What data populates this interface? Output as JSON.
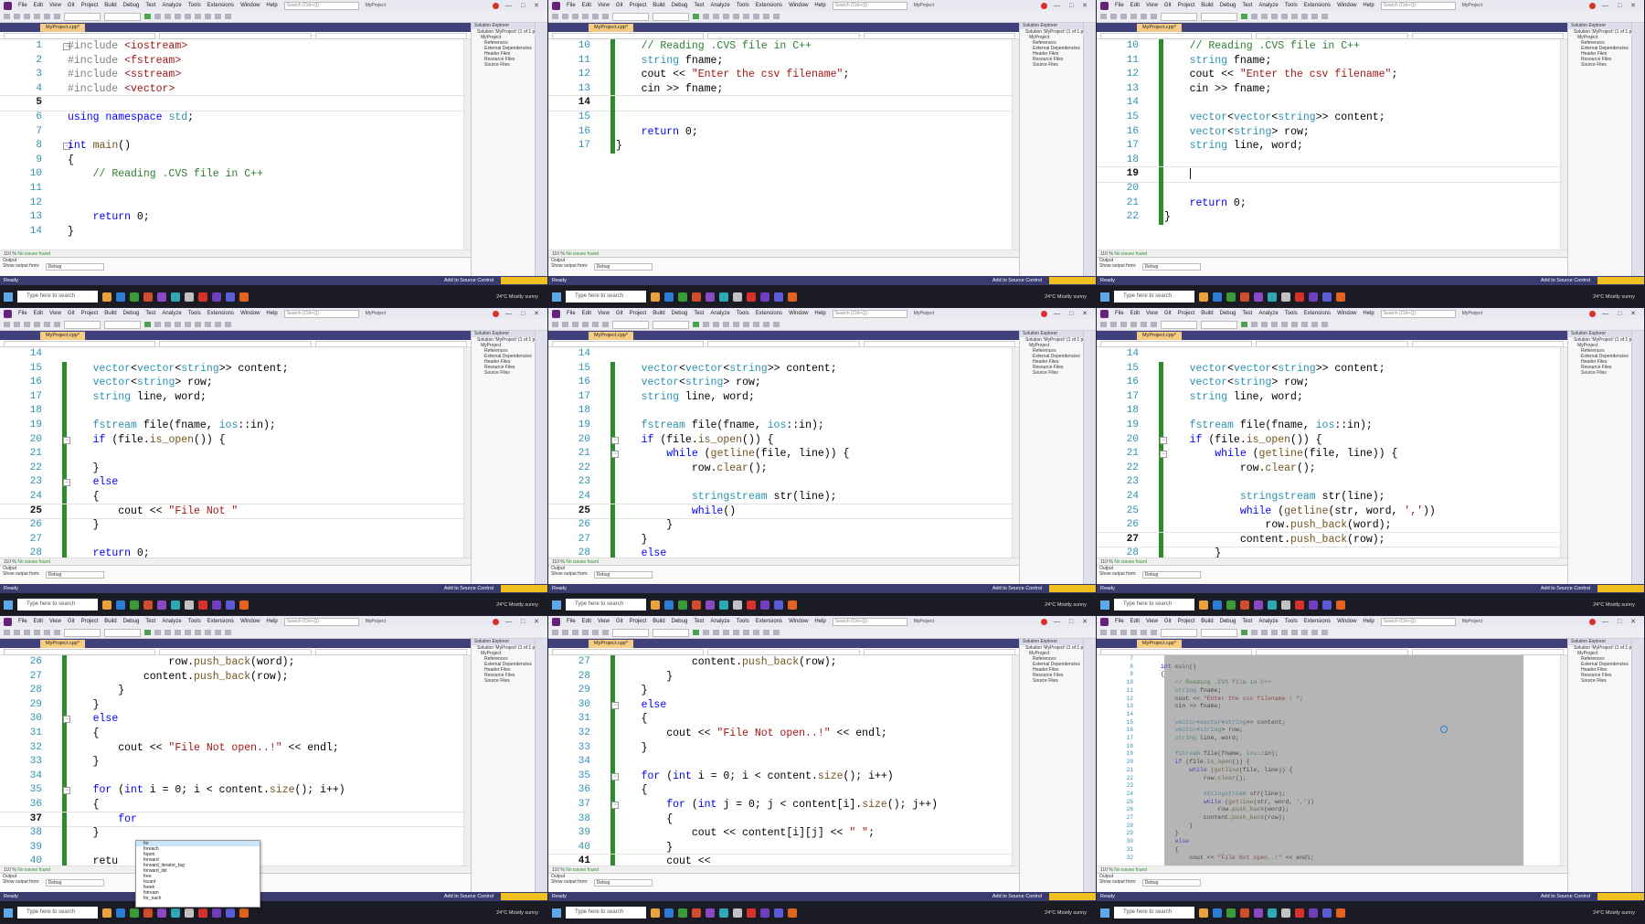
{
  "menu": [
    "File",
    "Edit",
    "View",
    "Git",
    "Project",
    "Build",
    "Debug",
    "Test",
    "Analyze",
    "Tools",
    "Extensions",
    "Window",
    "Help"
  ],
  "search_placeholder": "Search (Ctrl+Q)",
  "project_name": "MyProject",
  "tab_label": "MyProject.cpp*",
  "live_share": "Live Share",
  "status_ok": "No issues found",
  "output_title": "Output",
  "output_show": "Show output from:",
  "output_source": "Debug",
  "solution": {
    "title": "Solution Explorer",
    "items": [
      "Solution 'MyProject' (1 of 1 project)",
      "MyProject",
      "References",
      "External Dependencies",
      "Header Files",
      "Resource Files",
      "Source Files"
    ],
    "tabs": [
      "Solution Explorer",
      "Git Changes"
    ]
  },
  "vs_status": "Ready",
  "add_to_source": "Add to Source Control",
  "taskbar_search": "Type here to search",
  "weather": "24°C Mostly sunny",
  "clock_time": "",
  "colors": {
    "accent": "#68217a",
    "tab_active": "#f5cc84",
    "change_margin": "#2e8b2e",
    "statusbar": "#3a3b6e",
    "taskbar": "#1b1b24"
  },
  "panels": [
    {
      "lines": [
        {
          "n": "1",
          "t": "#include <iostream>"
        },
        {
          "n": "2",
          "t": "#include <fstream>"
        },
        {
          "n": "3",
          "t": "#include <sstream>"
        },
        {
          "n": "4",
          "t": "#include <vector>"
        },
        {
          "n": "5",
          "t": ""
        },
        {
          "n": "6",
          "t": "using namespace std;"
        },
        {
          "n": "7",
          "t": ""
        },
        {
          "n": "8",
          "t": "int main()"
        },
        {
          "n": "9",
          "t": "{"
        },
        {
          "n": "10",
          "t": "    // Reading .CVS file in C++"
        },
        {
          "n": "11",
          "t": ""
        },
        {
          "n": "12",
          "t": ""
        },
        {
          "n": "13",
          "t": "    return 0;"
        },
        {
          "n": "14",
          "t": "}"
        }
      ]
    },
    {
      "lines": [
        {
          "n": "10",
          "t": "    // Reading .CVS file in C++"
        },
        {
          "n": "11",
          "t": "    string fname;"
        },
        {
          "n": "12",
          "t": "    cout << \"Enter the csv filename\";"
        },
        {
          "n": "13",
          "t": "    cin >> fname;"
        },
        {
          "n": "14",
          "t": ""
        },
        {
          "n": "15",
          "t": ""
        },
        {
          "n": "16",
          "t": "    return 0;"
        },
        {
          "n": "17",
          "t": "}"
        }
      ]
    },
    {
      "lines": [
        {
          "n": "10",
          "t": "    // Reading .CVS file in C++"
        },
        {
          "n": "11",
          "t": "    string fname;"
        },
        {
          "n": "12",
          "t": "    cout << \"Enter the csv filename\";"
        },
        {
          "n": "13",
          "t": "    cin >> fname;"
        },
        {
          "n": "14",
          "t": ""
        },
        {
          "n": "15",
          "t": "    vector<vector<string>> content;"
        },
        {
          "n": "16",
          "t": "    vector<string> row;"
        },
        {
          "n": "17",
          "t": "    string line, word;"
        },
        {
          "n": "18",
          "t": ""
        },
        {
          "n": "19",
          "t": "    "
        },
        {
          "n": "20",
          "t": ""
        },
        {
          "n": "21",
          "t": "    return 0;"
        },
        {
          "n": "22",
          "t": "}"
        }
      ]
    },
    {
      "lines": [
        {
          "n": "14",
          "t": ""
        },
        {
          "n": "15",
          "t": "    vector<vector<string>> content;"
        },
        {
          "n": "16",
          "t": "    vector<string> row;"
        },
        {
          "n": "17",
          "t": "    string line, word;"
        },
        {
          "n": "18",
          "t": ""
        },
        {
          "n": "19",
          "t": "    fstream file(fname, ios::in);"
        },
        {
          "n": "20",
          "t": "    if (file.is_open()) {"
        },
        {
          "n": "21",
          "t": ""
        },
        {
          "n": "22",
          "t": "    }"
        },
        {
          "n": "23",
          "t": "    else"
        },
        {
          "n": "24",
          "t": "    {"
        },
        {
          "n": "25",
          "t": "        cout << \"File Not \""
        },
        {
          "n": "26",
          "t": "    }"
        },
        {
          "n": "27",
          "t": ""
        },
        {
          "n": "28",
          "t": "    return 0;"
        }
      ]
    },
    {
      "lines": [
        {
          "n": "14",
          "t": ""
        },
        {
          "n": "15",
          "t": "    vector<vector<string>> content;"
        },
        {
          "n": "16",
          "t": "    vector<string> row;"
        },
        {
          "n": "17",
          "t": "    string line, word;"
        },
        {
          "n": "18",
          "t": ""
        },
        {
          "n": "19",
          "t": "    fstream file(fname, ios::in);"
        },
        {
          "n": "20",
          "t": "    if (file.is_open()) {"
        },
        {
          "n": "21",
          "t": "        while (getline(file, line)) {"
        },
        {
          "n": "22",
          "t": "            row.clear();"
        },
        {
          "n": "23",
          "t": ""
        },
        {
          "n": "24",
          "t": "            stringstream str(line);"
        },
        {
          "n": "25",
          "t": "            while()"
        },
        {
          "n": "26",
          "t": "        }"
        },
        {
          "n": "27",
          "t": "    }"
        },
        {
          "n": "28",
          "t": "    else"
        }
      ]
    },
    {
      "lines": [
        {
          "n": "14",
          "t": ""
        },
        {
          "n": "15",
          "t": "    vector<vector<string>> content;"
        },
        {
          "n": "16",
          "t": "    vector<string> row;"
        },
        {
          "n": "17",
          "t": "    string line, word;"
        },
        {
          "n": "18",
          "t": ""
        },
        {
          "n": "19",
          "t": "    fstream file(fname, ios::in);"
        },
        {
          "n": "20",
          "t": "    if (file.is_open()) {"
        },
        {
          "n": "21",
          "t": "        while (getline(file, line)) {"
        },
        {
          "n": "22",
          "t": "            row.clear();"
        },
        {
          "n": "23",
          "t": ""
        },
        {
          "n": "24",
          "t": "            stringstream str(line);"
        },
        {
          "n": "25",
          "t": "            while (getline(str, word, ','))"
        },
        {
          "n": "26",
          "t": "                row.push_back(word);"
        },
        {
          "n": "27",
          "t": "            content.push_back(row);"
        },
        {
          "n": "28",
          "t": "        }"
        }
      ]
    },
    {
      "lines": [
        {
          "n": "26",
          "t": "                row.push_back(word);"
        },
        {
          "n": "27",
          "t": "            content.push_back(row);"
        },
        {
          "n": "28",
          "t": "        }"
        },
        {
          "n": "29",
          "t": "    }"
        },
        {
          "n": "30",
          "t": "    else"
        },
        {
          "n": "31",
          "t": "    {"
        },
        {
          "n": "32",
          "t": "        cout << \"File Not open..!\" << endl;"
        },
        {
          "n": "33",
          "t": "    }"
        },
        {
          "n": "34",
          "t": ""
        },
        {
          "n": "35",
          "t": "    for (int i = 0; i < content.size(); i++)"
        },
        {
          "n": "36",
          "t": "    {"
        },
        {
          "n": "37",
          "t": "        for"
        },
        {
          "n": "38",
          "t": "    }"
        },
        {
          "n": "39",
          "t": ""
        },
        {
          "n": "40",
          "t": "    retu"
        }
      ],
      "autocomplete": [
        "for",
        "foreach",
        "fopen",
        "forward",
        "forward_iterator_tag",
        "forward_list",
        "free",
        "fscanf",
        "fseek",
        "fstream",
        "for_each"
      ]
    },
    {
      "lines": [
        {
          "n": "27",
          "t": "            content.push_back(row);"
        },
        {
          "n": "28",
          "t": "        }"
        },
        {
          "n": "29",
          "t": "    }"
        },
        {
          "n": "30",
          "t": "    else"
        },
        {
          "n": "31",
          "t": "    {"
        },
        {
          "n": "32",
          "t": "        cout << \"File Not open..!\" << endl;"
        },
        {
          "n": "33",
          "t": "    }"
        },
        {
          "n": "34",
          "t": ""
        },
        {
          "n": "35",
          "t": "    for (int i = 0; i < content.size(); i++)"
        },
        {
          "n": "36",
          "t": "    {"
        },
        {
          "n": "37",
          "t": "        for (int j = 0; j < content[i].size(); j++)"
        },
        {
          "n": "38",
          "t": "        {"
        },
        {
          "n": "39",
          "t": "            cout << content[i][j] << \" \";"
        },
        {
          "n": "40",
          "t": "        }"
        },
        {
          "n": "41",
          "t": "        cout <<"
        }
      ]
    },
    {
      "lines": [
        {
          "n": "7",
          "t": ""
        },
        {
          "n": "8",
          "t": "int main()"
        },
        {
          "n": "9",
          "t": "{"
        },
        {
          "n": "10",
          "t": "    // Reading .CVS file in C++"
        },
        {
          "n": "11",
          "t": "    string fname;"
        },
        {
          "n": "12",
          "t": "    cout << \"Enter the csv filename : \";"
        },
        {
          "n": "13",
          "t": "    cin >> fname;"
        },
        {
          "n": "14",
          "t": ""
        },
        {
          "n": "15",
          "t": "    vector<vector<string>> content;"
        },
        {
          "n": "16",
          "t": "    vector<string> row;"
        },
        {
          "n": "17",
          "t": "    string line, word;"
        },
        {
          "n": "18",
          "t": ""
        },
        {
          "n": "19",
          "t": "    fstream file(fname, ios::in);"
        },
        {
          "n": "20",
          "t": "    if (file.is_open()) {"
        },
        {
          "n": "21",
          "t": "        while (getline(file, line)) {"
        },
        {
          "n": "22",
          "t": "            row.clear();"
        },
        {
          "n": "23",
          "t": ""
        },
        {
          "n": "24",
          "t": "            stringstream str(line);"
        },
        {
          "n": "25",
          "t": "            while (getline(str, word, ','))"
        },
        {
          "n": "26",
          "t": "                row.push_back(word);"
        },
        {
          "n": "27",
          "t": "            content.push_back(row);"
        },
        {
          "n": "28",
          "t": "        }"
        },
        {
          "n": "29",
          "t": "    }"
        },
        {
          "n": "30",
          "t": "    else"
        },
        {
          "n": "31",
          "t": "    {"
        },
        {
          "n": "32",
          "t": "        cout << \"File Not open..!\" << endl;"
        }
      ]
    }
  ]
}
